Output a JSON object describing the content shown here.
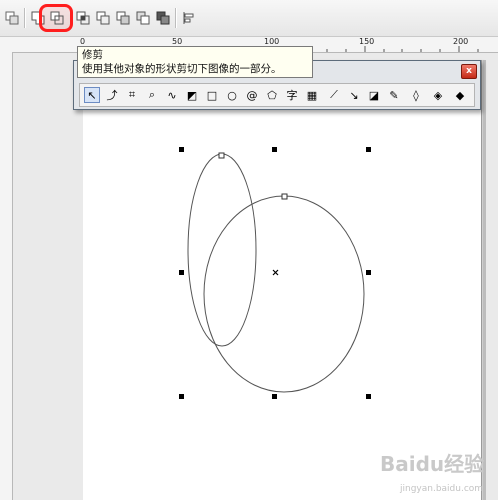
{
  "toolbar": {
    "buttons": [
      {
        "name": "combine-icon"
      },
      {
        "name": "weld-icon"
      },
      {
        "name": "trim-icon"
      },
      {
        "name": "intersect-icon"
      },
      {
        "name": "simplify-icon"
      },
      {
        "name": "front-minus-back-icon"
      },
      {
        "name": "back-minus-front-icon"
      },
      {
        "name": "create-boundary-icon"
      },
      {
        "name": "align-distribute-icon"
      }
    ],
    "highlight_color": "#ff1e1e"
  },
  "ruler": {
    "labels": [
      "0",
      "50",
      "100",
      "150",
      "200"
    ]
  },
  "tooltip": {
    "title": "修剪",
    "description": "使用其他对象的形状剪切下图像的一部分。"
  },
  "flyout": {
    "close_label": "x",
    "tools": [
      {
        "name": "pick-tool-icon",
        "glyph": "↖"
      },
      {
        "name": "shape-tool-icon",
        "glyph": "⤴"
      },
      {
        "name": "crop-tool-icon",
        "glyph": "⌗"
      },
      {
        "name": "zoom-tool-icon",
        "glyph": "⌕"
      },
      {
        "name": "freehand-tool-icon",
        "glyph": "∿"
      },
      {
        "name": "smart-fill-tool-icon",
        "glyph": "◩"
      },
      {
        "name": "rectangle-tool-icon",
        "glyph": "□"
      },
      {
        "name": "ellipse-tool-icon",
        "glyph": "○"
      },
      {
        "name": "spiral-tool-icon",
        "glyph": "@"
      },
      {
        "name": "basic-shapes-tool-icon",
        "glyph": "⬠"
      },
      {
        "name": "text-tool-icon",
        "glyph": "字"
      },
      {
        "name": "table-tool-icon",
        "glyph": "▦"
      },
      {
        "name": "dimension-tool-icon",
        "glyph": "⟋"
      },
      {
        "name": "connector-tool-icon",
        "glyph": "↘"
      },
      {
        "name": "blend-tool-icon",
        "glyph": "◪"
      },
      {
        "name": "eyedropper-tool-icon",
        "glyph": "✎"
      },
      {
        "name": "outline-tool-icon",
        "glyph": "◊"
      },
      {
        "name": "fill-tool-icon",
        "glyph": "◈"
      },
      {
        "name": "interactive-fill-tool-icon",
        "glyph": "◆"
      }
    ]
  },
  "watermark": {
    "text": "Baidu经验",
    "subtext": "jingyan.baidu.com"
  }
}
